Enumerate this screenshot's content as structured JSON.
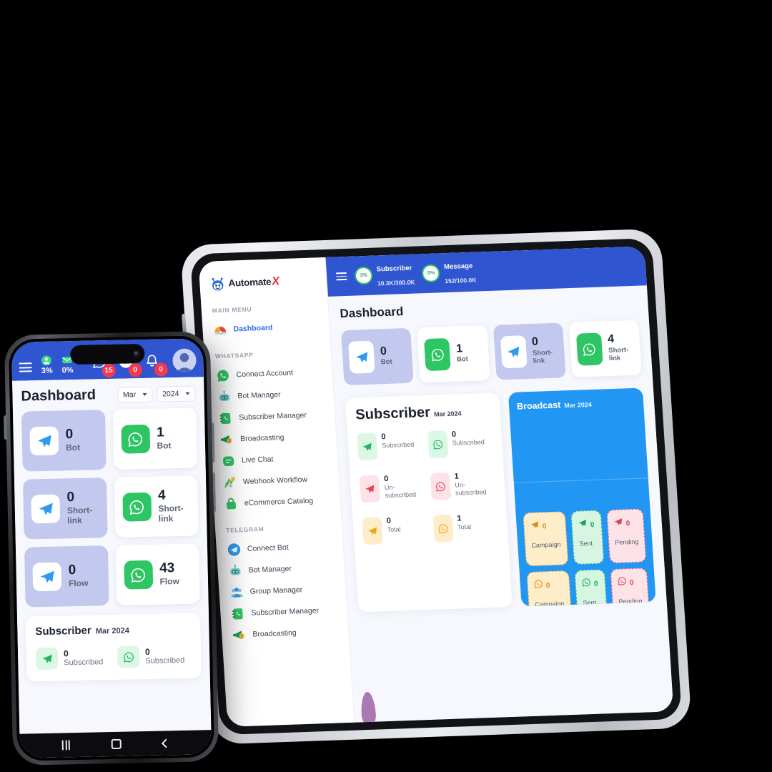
{
  "brand": {
    "name": "Automate",
    "accent_letter": "X",
    "logo_icon": "robot-logo-icon"
  },
  "colors": {
    "header_blue": "#2F55D1",
    "broadcast_blue": "#2196F3",
    "card_purple": "#C3C9EE",
    "whatsapp_green": "#2EC665",
    "telegram_blue": "#2E9BF0",
    "badge_red": "#F5384E",
    "active_link": "#2F6FE4"
  },
  "tablet": {
    "sidebar": {
      "groups": [
        {
          "label": "MAIN MENU",
          "items": [
            {
              "label": "Dashboard",
              "icon": "gauge-icon",
              "active": true
            }
          ]
        },
        {
          "label": "WHATSAPP",
          "items": [
            {
              "label": "Connect Account",
              "icon": "whatsapp-icon",
              "active": false
            },
            {
              "label": "Bot Manager",
              "icon": "robot-icon",
              "active": false
            },
            {
              "label": "Subscriber Manager",
              "icon": "contact-book-icon",
              "active": false
            },
            {
              "label": "Broadcasting",
              "icon": "megaphone-icon",
              "active": false
            },
            {
              "label": "Live Chat",
              "icon": "chat-bubble-icon",
              "active": false
            },
            {
              "label": "Webhook Workflow",
              "icon": "workflow-icon",
              "active": false
            },
            {
              "label": "eCommerce Catalog",
              "icon": "shopping-bag-icon",
              "active": false
            }
          ]
        },
        {
          "label": "TELEGRAM",
          "items": [
            {
              "label": "Connect Bot",
              "icon": "telegram-icon",
              "active": false
            },
            {
              "label": "Bot Manager",
              "icon": "robot-icon",
              "active": false
            },
            {
              "label": "Group Manager",
              "icon": "group-icon",
              "active": false
            },
            {
              "label": "Subscriber Manager",
              "icon": "contact-book-icon",
              "active": false
            },
            {
              "label": "Broadcasting",
              "icon": "megaphone-icon",
              "active": false
            }
          ]
        }
      ]
    },
    "topbar": {
      "menu_icon": "hamburger-icon",
      "quotas": [
        {
          "percent": "3%",
          "title": "Subscriber",
          "value": "10.3K/300.0K"
        },
        {
          "percent": "0%",
          "title": "Message",
          "value": "152/100.0K"
        }
      ]
    },
    "page_title": "Dashboard",
    "stat_cards": [
      {
        "value": "0",
        "label": "Bot",
        "icon": "telegram-icon",
        "style": "purple"
      },
      {
        "value": "1",
        "label": "Bot",
        "icon": "whatsapp-icon",
        "style": "white"
      },
      {
        "value": "0",
        "label": "Short-link",
        "icon": "telegram-icon",
        "style": "purple"
      },
      {
        "value": "4",
        "label": "Short-link",
        "icon": "whatsapp-icon",
        "style": "white"
      }
    ],
    "subscriber_panel": {
      "title": "Subscriber",
      "date": "Mar 2024",
      "items": [
        {
          "value": "0",
          "label": "Subscribed",
          "icon": "telegram-icon",
          "tone": "green"
        },
        {
          "value": "0",
          "label": "Subscribed",
          "icon": "whatsapp-icon",
          "tone": "green"
        },
        {
          "value": "0",
          "label": "Un-subscribed",
          "icon": "telegram-icon",
          "tone": "red"
        },
        {
          "value": "1",
          "label": "Un-subscribed",
          "icon": "whatsapp-icon",
          "tone": "red"
        },
        {
          "value": "0",
          "label": "Total",
          "icon": "telegram-icon",
          "tone": "yellow"
        },
        {
          "value": "1",
          "label": "Total",
          "icon": "whatsapp-icon",
          "tone": "yellow"
        }
      ]
    },
    "broadcast_panel": {
      "title": "Broadcast",
      "date": "Mar 2024",
      "tiles": [
        {
          "value": "0",
          "label": "Campaign",
          "icon": "telegram-icon",
          "tone": "camp"
        },
        {
          "value": "0",
          "label": "Sent",
          "icon": "telegram-icon",
          "tone": "sent"
        },
        {
          "value": "0",
          "label": "Pending",
          "icon": "telegram-icon",
          "tone": "pend"
        },
        {
          "value": "0",
          "label": "Campaign",
          "icon": "whatsapp-icon",
          "tone": "camp"
        },
        {
          "value": "0",
          "label": "Sent",
          "icon": "whatsapp-icon",
          "tone": "sent"
        },
        {
          "value": "0",
          "label": "Pending",
          "icon": "whatsapp-icon",
          "tone": "pend"
        }
      ]
    }
  },
  "phone": {
    "topbar": {
      "menu_icon": "hamburger-icon",
      "minis": [
        {
          "icon": "person-icon",
          "value": "3%"
        },
        {
          "icon": "mail-icon",
          "value": "0%"
        }
      ],
      "badges": [
        {
          "icon": "whatsapp-icon",
          "count": "15"
        },
        {
          "icon": "telegram-icon",
          "count": "0"
        },
        {
          "icon": "bell-icon",
          "count": "0"
        }
      ],
      "avatar": "avatar-icon"
    },
    "page_title": "Dashboard",
    "month_select": "Mar",
    "year_select": "2024",
    "stat_cards": [
      {
        "value": "0",
        "label": "Bot",
        "icon": "telegram-icon",
        "style": "purple"
      },
      {
        "value": "1",
        "label": "Bot",
        "icon": "whatsapp-icon",
        "style": "white"
      },
      {
        "value": "0",
        "label": "Short-link",
        "icon": "telegram-icon",
        "style": "purple"
      },
      {
        "value": "4",
        "label": "Short-link",
        "icon": "whatsapp-icon",
        "style": "white"
      },
      {
        "value": "0",
        "label": "Flow",
        "icon": "telegram-icon",
        "style": "purple"
      },
      {
        "value": "43",
        "label": "Flow",
        "icon": "whatsapp-icon",
        "style": "white"
      }
    ],
    "subscriber_panel": {
      "title": "Subscriber",
      "date": "Mar 2024",
      "items": [
        {
          "value": "0",
          "label": "Subscribed",
          "icon": "telegram-icon"
        },
        {
          "value": "0",
          "label": "Subscribed",
          "icon": "whatsapp-icon"
        }
      ]
    },
    "navbar": {
      "recents": "recents-icon",
      "home": "home-icon",
      "back": "back-icon"
    }
  }
}
